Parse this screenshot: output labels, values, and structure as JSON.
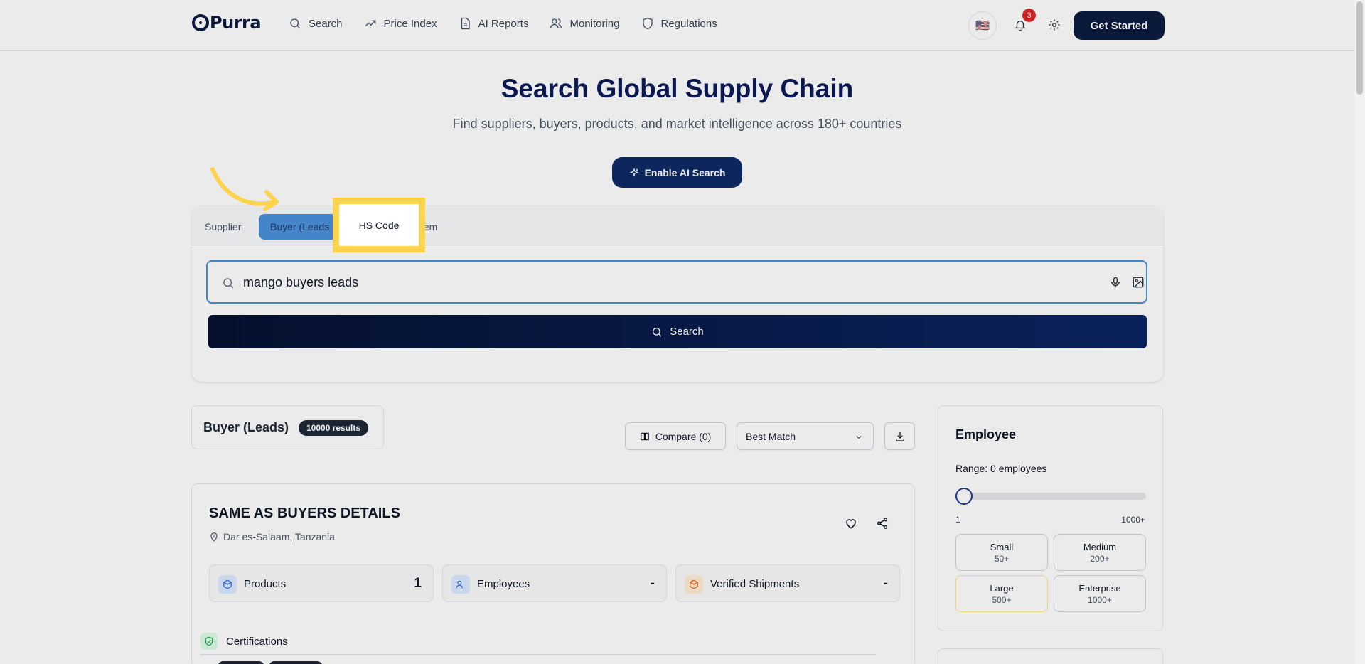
{
  "header": {
    "logo": "Purra",
    "nav": [
      {
        "label": "Search",
        "icon": "search-icon"
      },
      {
        "label": "Price Index",
        "icon": "trending-up-icon"
      },
      {
        "label": "AI Reports",
        "icon": "document-icon"
      },
      {
        "label": "Monitoring",
        "icon": "users-icon"
      },
      {
        "label": "Regulations",
        "icon": "shield-icon"
      }
    ],
    "flag": "🇺🇸",
    "notification_count": "3",
    "cta_label": "Get Started"
  },
  "hero": {
    "title": "Search Global Supply Chain",
    "subtitle": "Find suppliers, buyers, products, and market intelligence across 180+ countries",
    "ai_button": "Enable AI Search"
  },
  "search": {
    "tabs": [
      "Supplier",
      "Buyer (Leads",
      "HS Code",
      "tem"
    ],
    "query": "mango buyers leads",
    "button_label": "Search"
  },
  "results": {
    "title": "Buyer (Leads)",
    "count_badge": "10000 results",
    "compare_label": "Compare (0)",
    "sort_value": "Best Match"
  },
  "card": {
    "name": "SAME AS BUYERS DETAILS",
    "location": "Dar es-Salaam, Tanzania",
    "stats": [
      {
        "label": "Products",
        "value": "1"
      },
      {
        "label": "Employees",
        "value": "-"
      },
      {
        "label": "Verified Shipments",
        "value": "-"
      }
    ],
    "certifications_label": "Certifications"
  },
  "employee_filter": {
    "title": "Employee",
    "range_label": "Range: 0 employees",
    "min_label": "1",
    "max_label": "1000+",
    "sizes": [
      {
        "label": "Small",
        "count": "50+"
      },
      {
        "label": "Medium",
        "count": "200+"
      },
      {
        "label": "Large",
        "count": "500+"
      },
      {
        "label": "Enterprise",
        "count": "1000+"
      }
    ]
  },
  "colors": {
    "brand_navy": "#0b1b3f",
    "active_tab": "#4a90d9",
    "highlight": "#fcd34d",
    "badge_red": "#dc2626"
  }
}
